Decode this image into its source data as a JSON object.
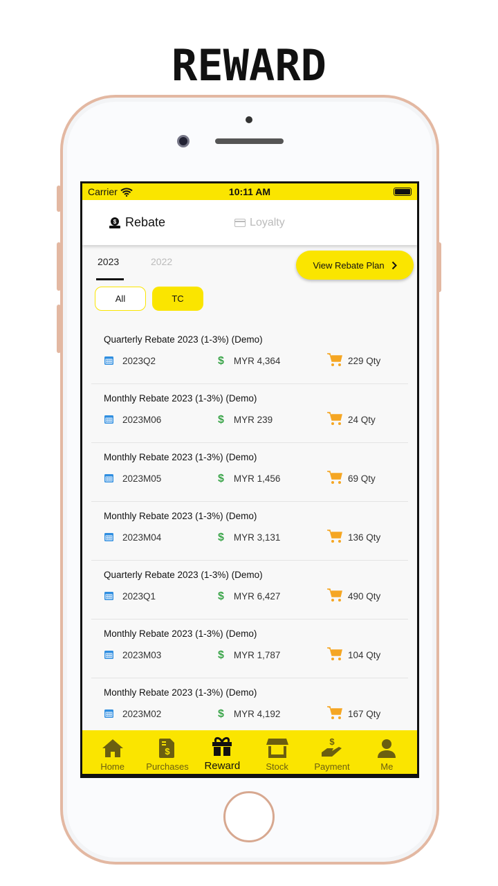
{
  "heading": "REWARD",
  "status": {
    "carrier": "Carrier",
    "time": "10:11 AM"
  },
  "tabs": {
    "rebate": "Rebate",
    "loyalty": "Loyalty"
  },
  "years": [
    "2023",
    "2022"
  ],
  "view_plan_label": "View Rebate Plan",
  "filters": [
    "All",
    "TC"
  ],
  "colors": {
    "accent": "#fae500",
    "calendar": "#2f8ee0",
    "money": "#3ba54a",
    "cart": "#f5a623"
  },
  "rows": [
    {
      "title": "Quarterly Rebate 2023 (1-3%) (Demo)",
      "period": "2023Q2",
      "amount": "MYR 4,364",
      "qty": "229 Qty"
    },
    {
      "title": "Monthly Rebate 2023 (1-3%) (Demo)",
      "period": "2023M06",
      "amount": "MYR 239",
      "qty": "24 Qty"
    },
    {
      "title": "Monthly Rebate 2023 (1-3%) (Demo)",
      "period": "2023M05",
      "amount": "MYR 1,456",
      "qty": "69 Qty"
    },
    {
      "title": "Monthly Rebate 2023 (1-3%) (Demo)",
      "period": "2023M04",
      "amount": "MYR 3,131",
      "qty": "136 Qty"
    },
    {
      "title": "Quarterly Rebate 2023 (1-3%) (Demo)",
      "period": "2023Q1",
      "amount": "MYR 6,427",
      "qty": "490 Qty"
    },
    {
      "title": "Monthly Rebate 2023 (1-3%) (Demo)",
      "period": "2023M03",
      "amount": "MYR 1,787",
      "qty": "104 Qty"
    },
    {
      "title": "Monthly Rebate 2023 (1-3%) (Demo)",
      "period": "2023M02",
      "amount": "MYR 4,192",
      "qty": "167 Qty"
    }
  ],
  "nav": [
    {
      "label": "Home",
      "icon": "home-icon"
    },
    {
      "label": "Purchases",
      "icon": "invoice-icon"
    },
    {
      "label": "Reward",
      "icon": "gift-icon",
      "active": true
    },
    {
      "label": "Stock",
      "icon": "store-icon"
    },
    {
      "label": "Payment",
      "icon": "hand-dollar-icon"
    },
    {
      "label": "Me",
      "icon": "user-icon"
    }
  ]
}
